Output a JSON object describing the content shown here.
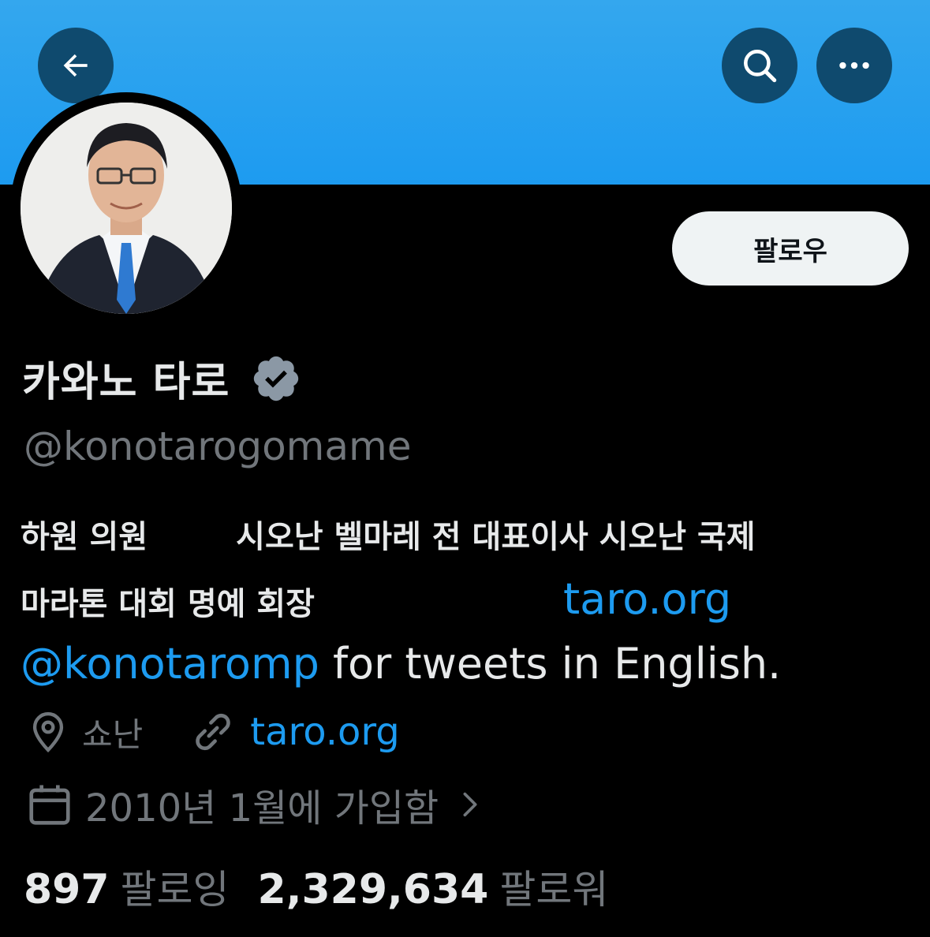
{
  "header": {
    "back_icon": "arrow-left-icon",
    "search_icon": "search-icon",
    "more_icon": "more-horizontal-icon",
    "banner_color": "#1d9bf0"
  },
  "profile": {
    "follow_label": "팔로우",
    "display_name": "카와노 타로",
    "handle": "@konotarogomame",
    "bio": {
      "line1_a": "하원 의원",
      "line1_b": "시오난 벨마레 전 대표이사 시오난 국제",
      "line2": "마라톤 대회 명예 회장",
      "line2_link": "taro.org",
      "line3_mention": "@konotaromp",
      "line3_text": " for tweets in English."
    },
    "location": "쇼난",
    "website": "taro.org",
    "joined": "2010년 1월에 가입함",
    "following_count": "897",
    "following_label": "팔로잉",
    "followers_count": "2,329,634",
    "followers_label": "팔로워"
  },
  "colors": {
    "link": "#1d9bf0",
    "muted": "#71767b",
    "text": "#e7e9ea"
  }
}
